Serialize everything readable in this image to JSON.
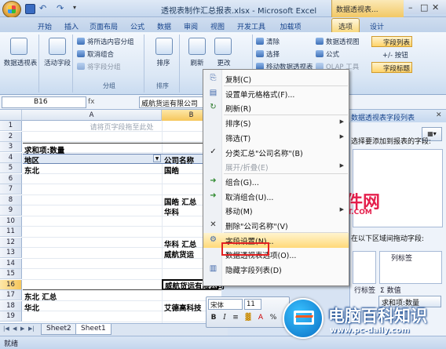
{
  "window": {
    "title": "透视表制作汇总报表.xlsx - Microsoft Excel",
    "context_title": "数据透视表..."
  },
  "tabs": [
    "开始",
    "插入",
    "页面布局",
    "公式",
    "数据",
    "审阅",
    "视图",
    "开发工具",
    "加载项",
    "选项",
    "设计"
  ],
  "ribbon": {
    "pivot_table_label": "数据透视表",
    "active_field_label": "活动字段",
    "group_items": [
      "将所选内容分组",
      "取消组合",
      "将字段分组"
    ],
    "group_label": "分组",
    "sort_label": "排序",
    "sort_group_label": "排序",
    "refresh_label": "刷新",
    "change_label": "更改",
    "data_items": [
      "清除",
      "选择",
      "移动数据透视表"
    ],
    "tools_items": [
      "数据透视图",
      "公式",
      "OLAP 工具"
    ],
    "show_items": [
      "字段列表",
      "+/- 按钮",
      "字段标题"
    ]
  },
  "formula_bar": {
    "name_box": "B16",
    "value": "威航货运有限公司"
  },
  "columns": [
    "A",
    "B"
  ],
  "rows": [
    "1",
    "2",
    "3",
    "4",
    "5",
    "6",
    "7",
    "8",
    "9",
    "10",
    "11",
    "12",
    "13",
    "14",
    "15",
    "16",
    "17",
    "18",
    "19"
  ],
  "cells": {
    "r1_hint": "请将页字段拖至此处",
    "r3_a": "求和项:数量",
    "r4_a": "地区",
    "r4_b": "公司名称",
    "r5_a": "东北",
    "r5_b": "国皓",
    "r7_b": "国皓 汇总",
    "r8_b": "华科",
    "r11_b": "华科 汇总",
    "r12_b": "威航货运",
    "r16_b": "威航货运有限公司",
    "r17_a": "东北 汇总",
    "r18_a": "华北",
    "r18_b": "艾德高科技"
  },
  "sheets": [
    "Sheet2",
    "Sheet1"
  ],
  "status": "就绪",
  "field_pane": {
    "title": "数据透视表字段列表",
    "prompt": "选择要添加到报表的字段:",
    "drag_label": "在以下区域间拖动字段:",
    "col_label": "列标签",
    "row_label": "行标签",
    "value_title": "数值",
    "value_item": "求和项:数量"
  },
  "context_menu": [
    {
      "label": "复制(C)",
      "icon": "copy-icon",
      "arrow": false
    },
    {
      "label": "设置单元格格式(F)...",
      "icon": "format-cells-icon",
      "arrow": false
    },
    {
      "label": "刷新(R)",
      "icon": "refresh-icon",
      "arrow": false
    },
    {
      "label": "排序(S)",
      "icon": "",
      "arrow": true
    },
    {
      "label": "筛选(T)",
      "icon": "",
      "arrow": true
    },
    {
      "label": "分类汇总\"公司名称\"(B)",
      "icon": "check-icon",
      "arrow": false
    },
    {
      "label": "展开/折叠(E)",
      "icon": "",
      "arrow": true,
      "disabled": true
    },
    {
      "label": "组合(G)...",
      "icon": "group-icon",
      "arrow": false
    },
    {
      "label": "取消组合(U)...",
      "icon": "ungroup-icon",
      "arrow": false
    },
    {
      "label": "移动(M)",
      "icon": "",
      "arrow": true
    },
    {
      "label": "删除\"公司名称\"(V)",
      "icon": "delete-icon",
      "arrow": false
    },
    {
      "label": "字段设置(N)...",
      "icon": "field-settings-icon",
      "arrow": false,
      "highlighted": true
    },
    {
      "label": "数据透视表选项(O)...",
      "icon": "",
      "arrow": false
    },
    {
      "label": "隐藏字段列表(D)",
      "icon": "field-list-icon",
      "arrow": false
    }
  ],
  "mini_toolbar": {
    "font": "宋体",
    "size": "11",
    "buttons": [
      "B",
      "I",
      "≡"
    ]
  },
  "watermarks": {
    "brand1": "第九软件网",
    "brand1_url": "WWW.D9SOFT.COM",
    "brand2": "电脑百科知识",
    "brand2_url": "www.pc-daily.com"
  },
  "colors": {
    "accent": "#f2c865",
    "highlight_box": "#e42222",
    "ribbon": "#dbe7f5"
  }
}
